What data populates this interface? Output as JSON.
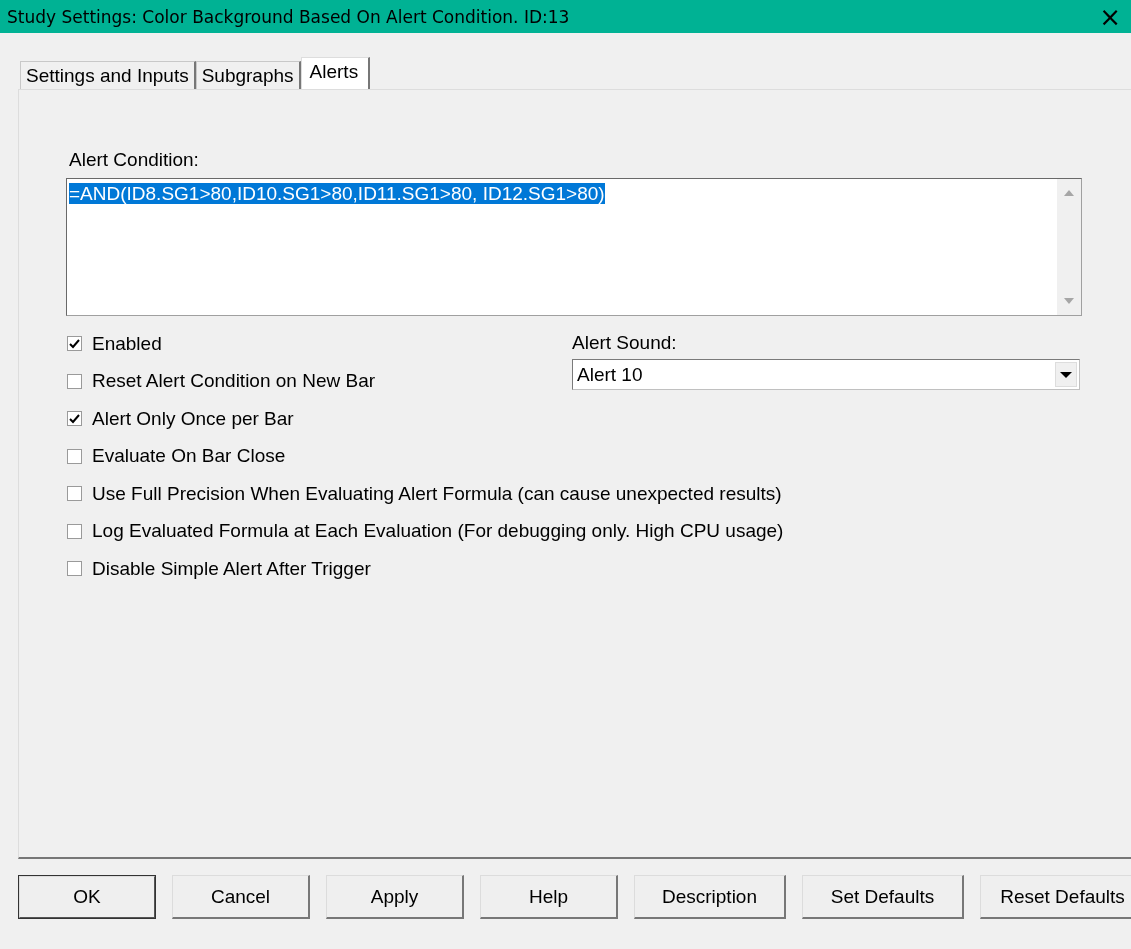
{
  "window": {
    "title": "Study Settings: Color Background Based On Alert Condition. ID:13",
    "close": "×"
  },
  "tabs": [
    {
      "label": "Settings and Inputs",
      "selected": false
    },
    {
      "label": "Subgraphs",
      "selected": false
    },
    {
      "label": "Alerts",
      "selected": true
    }
  ],
  "alert_condition": {
    "label": "Alert Condition:",
    "value": "=AND(ID8.SG1>80,ID10.SG1>80,ID11.SG1>80, ID12.SG1>80)",
    "selected": true
  },
  "options": [
    {
      "label": "Enabled",
      "checked": true
    },
    {
      "label": "Reset Alert Condition on New Bar",
      "checked": false
    },
    {
      "label": "Alert Only Once per Bar",
      "checked": true
    },
    {
      "label": "Evaluate On Bar Close",
      "checked": false
    },
    {
      "label": "Use Full Precision When Evaluating Alert Formula (can cause unexpected results)",
      "checked": false
    },
    {
      "label": "Log Evaluated Formula at Each Evaluation (For debugging only. High CPU usage)",
      "checked": false
    },
    {
      "label": "Disable Simple Alert After Trigger",
      "checked": false
    }
  ],
  "alert_sound": {
    "label": "Alert Sound:",
    "value": "Alert 10"
  },
  "buttons": [
    {
      "label": "OK",
      "selected": true
    },
    {
      "label": "Cancel",
      "selected": false
    },
    {
      "label": "Apply",
      "selected": false
    },
    {
      "label": "Help",
      "selected": false
    },
    {
      "label": "Description",
      "selected": false
    },
    {
      "label": "Set Defaults",
      "selected": false
    },
    {
      "label": "Reset Defaults",
      "selected": false
    }
  ]
}
